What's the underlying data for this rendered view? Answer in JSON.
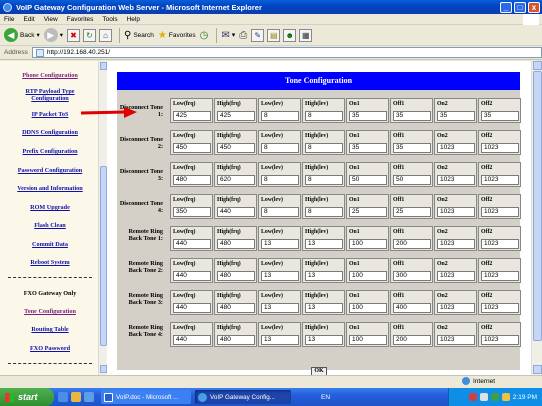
{
  "window": {
    "title": "VoIP Gateway Configuration Web Server - Microsoft Internet Explorer",
    "min": "_",
    "max": "□",
    "close": "x"
  },
  "menu": [
    "File",
    "Edit",
    "View",
    "Favorites",
    "Tools",
    "Help"
  ],
  "toolbar": {
    "back": "Back",
    "search": "Search",
    "favorites": "Favorites"
  },
  "address": {
    "label": "Address",
    "url": "http://192.168.40.251/"
  },
  "sidebar": {
    "items": [
      "Phone Configuration",
      "RTP Payload Type Configuration",
      "IP Packet ToS",
      "DDNS Configuration",
      "Prefix Configuration",
      "Password Configuration",
      "Version and Information",
      "ROM Upgrade",
      "Flash Clean",
      "Commit Data",
      "Reboot System"
    ],
    "fxo_header": "FXO Gateway Only",
    "fxo_items": [
      "Tone Configuration",
      "Routing Table",
      "FXO Password"
    ]
  },
  "tone": {
    "title": "Tone Configuration",
    "headers": [
      "Low(frq)",
      "High(frq)",
      "Low(lev)",
      "High(lev)",
      "On1",
      "Off1",
      "On2",
      "Off2"
    ],
    "rows": [
      {
        "label": "Disconnect Tone 1:",
        "values": [
          "425",
          "425",
          "8",
          "8",
          "35",
          "35",
          "35",
          "35"
        ]
      },
      {
        "label": "Disconnect Tone 2:",
        "values": [
          "450",
          "450",
          "8",
          "8",
          "35",
          "35",
          "1023",
          "1023"
        ]
      },
      {
        "label": "Disconnect Tone 3:",
        "values": [
          "480",
          "620",
          "8",
          "8",
          "50",
          "50",
          "1023",
          "1023"
        ]
      },
      {
        "label": "Disconnect Tone 4:",
        "values": [
          "350",
          "440",
          "8",
          "8",
          "25",
          "25",
          "1023",
          "1023"
        ]
      },
      {
        "label": "Remote Ring Back Tone 1:",
        "values": [
          "440",
          "480",
          "13",
          "13",
          "100",
          "200",
          "1023",
          "1023"
        ]
      },
      {
        "label": "Remote Ring Back Tone 2:",
        "values": [
          "440",
          "480",
          "13",
          "13",
          "100",
          "300",
          "1023",
          "1023"
        ]
      },
      {
        "label": "Remote Ring Back Tone 3:",
        "values": [
          "440",
          "480",
          "13",
          "13",
          "100",
          "400",
          "1023",
          "1023"
        ]
      },
      {
        "label": "Remote Ring Back Tone 4:",
        "values": [
          "440",
          "480",
          "13",
          "13",
          "100",
          "200",
          "1023",
          "1023"
        ]
      }
    ],
    "ok_label": "OK"
  },
  "status": {
    "zone": "Internet"
  },
  "taskbar": {
    "start": "start",
    "tasks": [
      "VoIP.doc - Microsoft ...",
      "VoIP Gateway Config..."
    ],
    "lang": "EN",
    "clock": "2:19 PM"
  },
  "colors": {
    "title_blue": "#0000ff",
    "link": "#1010a8",
    "arrow": "#e00000"
  }
}
